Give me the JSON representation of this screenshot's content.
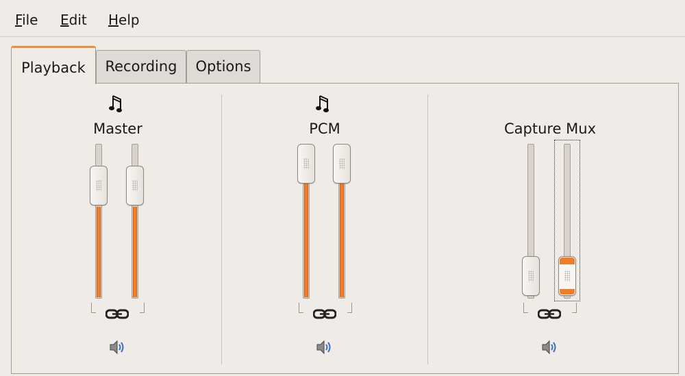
{
  "menubar": {
    "items": [
      {
        "mnemonic": "F",
        "rest": "ile"
      },
      {
        "mnemonic": "E",
        "rest": "dit"
      },
      {
        "mnemonic": "H",
        "rest": "elp"
      }
    ]
  },
  "tabs": [
    {
      "label": "Playback",
      "active": true
    },
    {
      "label": "Recording",
      "active": false
    },
    {
      "label": "Options",
      "active": false
    }
  ],
  "channels": [
    {
      "label": "Master",
      "icon": "music-note-icon",
      "left_level_percent": 72,
      "right_level_percent": 72,
      "locked": true,
      "muted": false
    },
    {
      "label": "PCM",
      "icon": "music-note-icon",
      "left_level_percent": 100,
      "right_level_percent": 100,
      "locked": true,
      "muted": false
    },
    {
      "label": "Capture Mux",
      "icon": "",
      "left_level_percent": 0,
      "right_level_percent": 0,
      "locked": true,
      "muted": false,
      "focused_slider": "right"
    }
  ],
  "colors": {
    "accent": "#f07d2a",
    "window_bg": "#efebe7",
    "speaker_waves": "#3b6fc4"
  }
}
